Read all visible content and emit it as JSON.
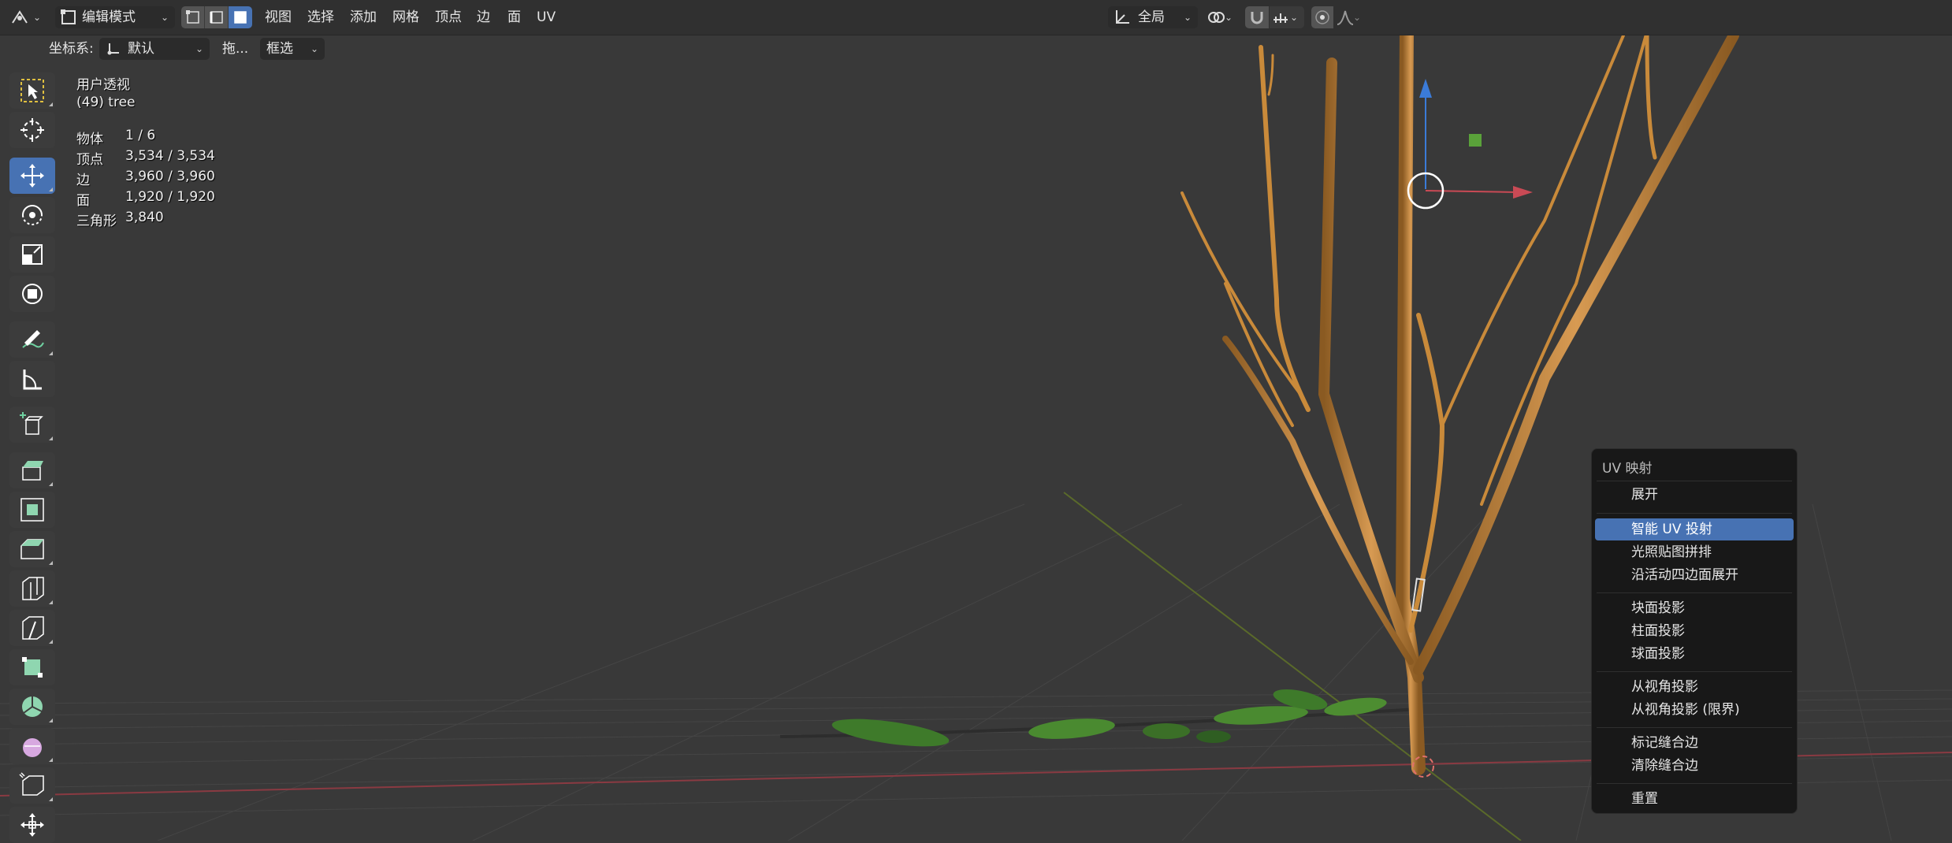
{
  "header": {
    "mode": "编辑模式",
    "menus": [
      "视图",
      "选择",
      "添加",
      "网格",
      "顶点",
      "边",
      "面",
      "UV"
    ],
    "transform_orientation": "全局"
  },
  "tool_settings": {
    "coord_label": "坐标系:",
    "coord_value": "默认",
    "drag_label": "拖...",
    "select_mode": "框选"
  },
  "viewport_info": {
    "view_name": "用户透视",
    "object_name": "(49) tree",
    "stats": [
      {
        "label": "物体",
        "value": "1 / 6"
      },
      {
        "label": "顶点",
        "value": "3,534 / 3,534"
      },
      {
        "label": "边",
        "value": "3,960 / 3,960"
      },
      {
        "label": "面",
        "value": "1,920 / 1,920"
      },
      {
        "label": "三角形",
        "value": "3,840"
      }
    ]
  },
  "context_menu": {
    "title": "UV 映射",
    "items": [
      {
        "label": "展开",
        "highlighted": false
      },
      {
        "label": "智能 UV 投射",
        "highlighted": true
      },
      {
        "label": "光照贴图拼排",
        "highlighted": false
      },
      {
        "label": "沿活动四边面展开",
        "highlighted": false
      },
      {
        "label": "块面投影",
        "highlighted": false
      },
      {
        "label": "柱面投影",
        "highlighted": false
      },
      {
        "label": "球面投影",
        "highlighted": false
      },
      {
        "label": "从视角投影",
        "highlighted": false
      },
      {
        "label": "从视角投影 (限界)",
        "highlighted": false
      },
      {
        "label": "标记缝合边",
        "highlighted": false
      },
      {
        "label": "清除缝合边",
        "highlighted": false
      },
      {
        "label": "重置",
        "highlighted": false
      }
    ]
  },
  "toolbar": {
    "tools": [
      "select-box-tool",
      "cursor-tool",
      "move-tool",
      "rotate-tool",
      "scale-tool",
      "transform-tool",
      "annotate-tool",
      "measure-tool",
      "add-cube-tool",
      "extrude-tool",
      "inset-tool",
      "bevel-tool",
      "loop-cut-tool",
      "knife-tool",
      "poly-build-tool",
      "spin-tool",
      "smooth-tool",
      "shear-tool",
      "move-extra-tool"
    ],
    "active": "move-tool"
  },
  "colors": {
    "accent": "#4772b3",
    "viewport_bg": "#393939",
    "menu_bg": "#181818",
    "axis_x": "#c94a55",
    "axis_z": "#3b7bd8",
    "branch": "#c98a3a",
    "leaf": "#3e7a2a"
  }
}
